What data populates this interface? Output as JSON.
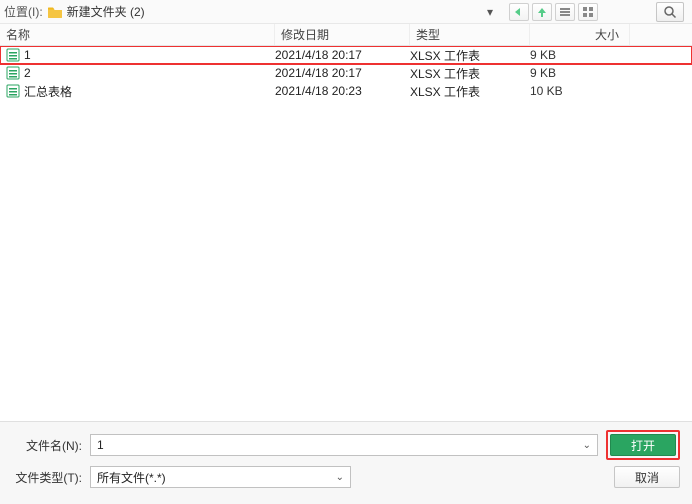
{
  "topbar": {
    "location_label": "位置(I):",
    "folder_name": "新建文件夹 (2)"
  },
  "columns": {
    "name": "名称",
    "date": "修改日期",
    "type": "类型",
    "size": "大小"
  },
  "files": [
    {
      "name": "1",
      "date": "2021/4/18 20:17",
      "type": "XLSX 工作表",
      "size": "9 KB",
      "highlighted": true
    },
    {
      "name": "2",
      "date": "2021/4/18 20:17",
      "type": "XLSX 工作表",
      "size": "9 KB",
      "highlighted": false
    },
    {
      "name": "汇总表格",
      "date": "2021/4/18 20:23",
      "type": "XLSX 工作表",
      "size": "10 KB",
      "highlighted": false
    }
  ],
  "bottom": {
    "filename_label": "文件名(N):",
    "filename_value": "1",
    "filetype_label": "文件类型(T):",
    "filetype_value": "所有文件(*.*)",
    "open_label": "打开",
    "cancel_label": "取消"
  }
}
